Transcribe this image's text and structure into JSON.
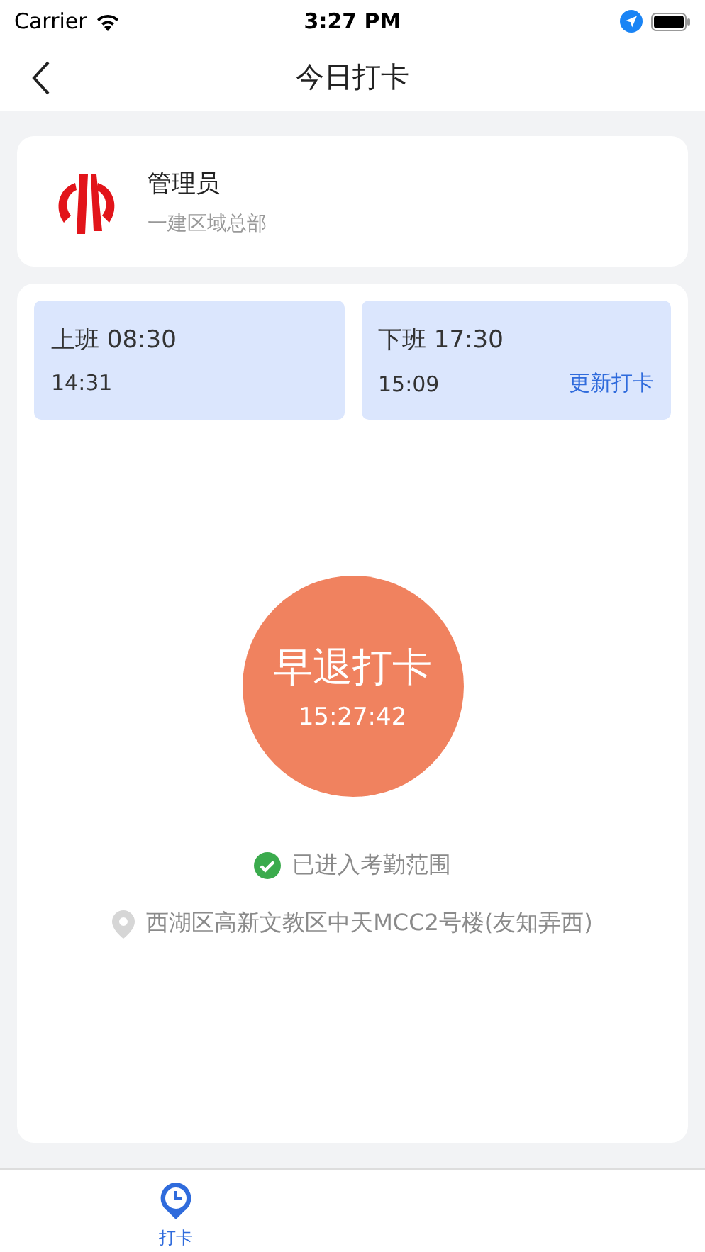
{
  "status_bar": {
    "carrier": "Carrier",
    "time": "3:27 PM"
  },
  "nav": {
    "title": "今日打卡"
  },
  "profile": {
    "name": "管理员",
    "department": "一建区域总部"
  },
  "shifts": [
    {
      "label": "上班 08:30",
      "punched": "14:31"
    },
    {
      "label": "下班 17:30",
      "punched": "15:09",
      "action": "更新打卡"
    }
  ],
  "punch_button": {
    "label": "早退打卡",
    "time": "15:27:42"
  },
  "range_status": {
    "text": "已进入考勤范围",
    "in_range": true
  },
  "location": "西湖区高新文教区中天MCC2号楼(友知弄西)",
  "tabs": [
    {
      "label": "打卡",
      "selected": true
    }
  ]
}
